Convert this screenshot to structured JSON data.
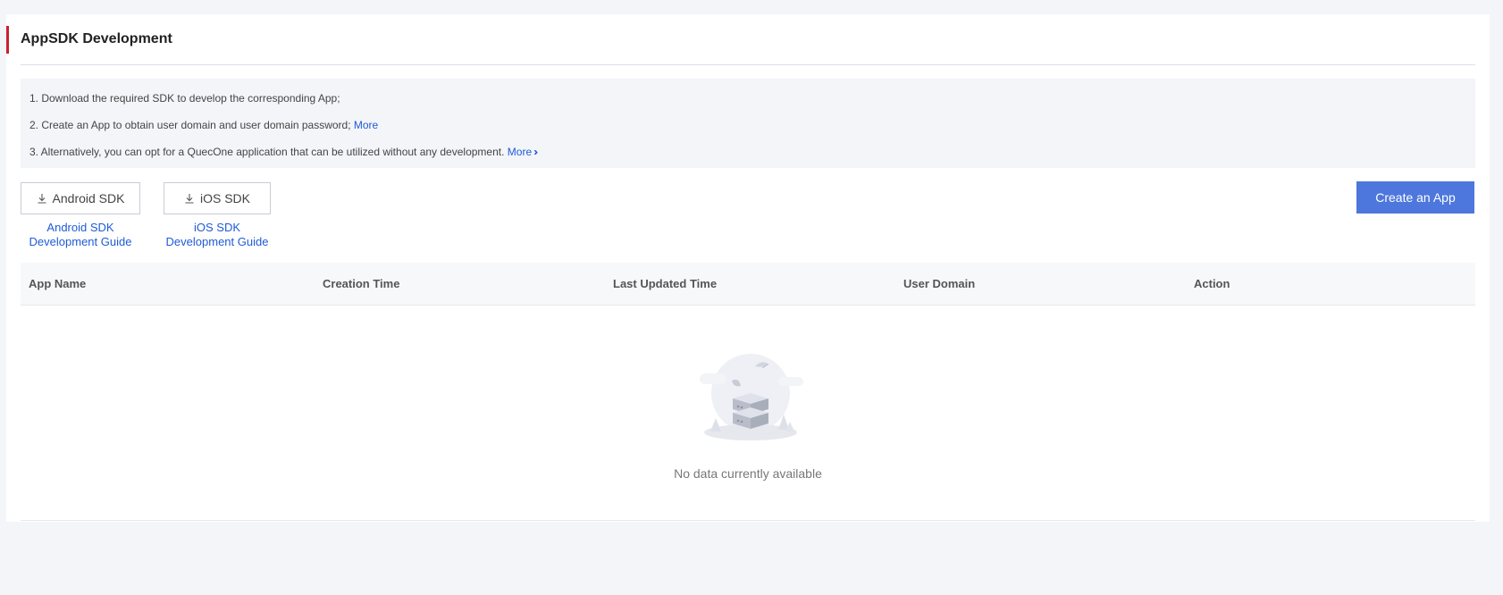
{
  "page": {
    "title": "AppSDK Development"
  },
  "tips": [
    {
      "text": "1. Download the required SDK to develop the corresponding App;"
    },
    {
      "text": "2. Create an App to obtain user domain and user domain password; ",
      "link": "More"
    },
    {
      "text": "3. Alternatively, you can opt for a QuecOne application that can be utilized without any development. ",
      "link": "More"
    }
  ],
  "sdk_buttons": {
    "android": {
      "label": "Android SDK",
      "guide_line1": "Android SDK",
      "guide_line2": "Development Guide"
    },
    "ios": {
      "label": "iOS SDK",
      "guide_line1": "iOS SDK",
      "guide_line2": "Development Guide"
    }
  },
  "create_button": {
    "label": "Create an App"
  },
  "table": {
    "columns": [
      "App Name",
      "Creation Time",
      "Last Updated Time",
      "User Domain",
      "Action"
    ],
    "empty_text": "No data currently available"
  },
  "colors": {
    "accent": "#c9202d",
    "link": "#1f5bd6",
    "primary_button": "#4d77dc"
  },
  "icons": {
    "download": "download-icon",
    "chevron": "double-chevron-right-icon",
    "empty": "empty-server-illustration"
  }
}
